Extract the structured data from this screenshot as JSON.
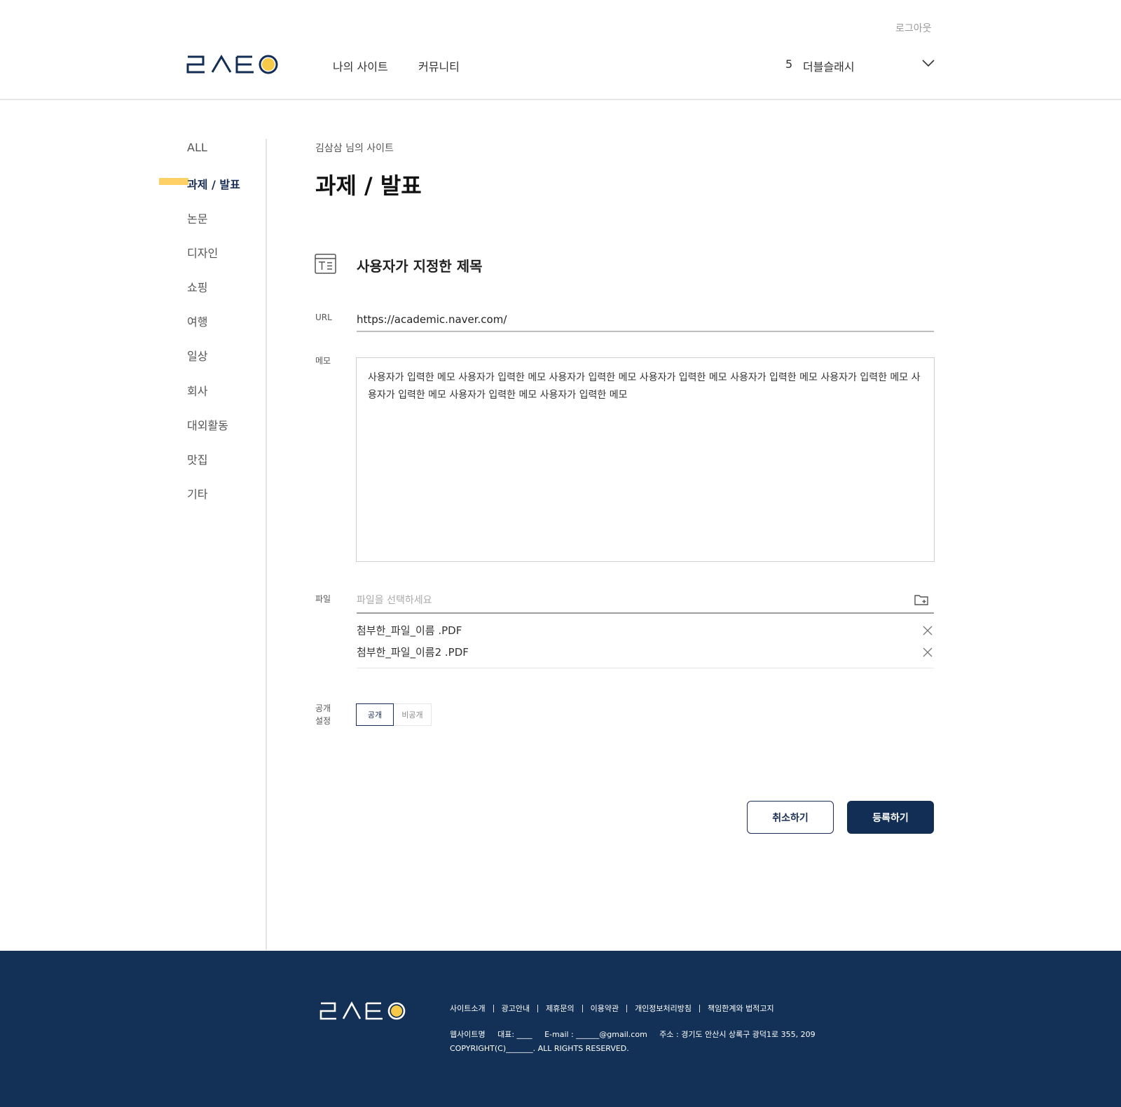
{
  "header": {
    "logout_label": "로그아웃",
    "nav": [
      "나의 사이트",
      "커뮤니티"
    ],
    "user_count": "5",
    "user_name": "더블슬래시"
  },
  "sidebar": {
    "items": [
      "ALL",
      "과제 / 발표",
      "논문",
      "디자인",
      "쇼핑",
      "여행",
      "일상",
      "회사",
      "대외활동",
      "맛집",
      "기타"
    ],
    "active_index": 1
  },
  "main": {
    "breadcrumb": "김삼삼 님의 사이트",
    "page_title": "과제 / 발표",
    "custom_title": "사용자가 지정한 제목",
    "url_label": "URL",
    "url_value": "https://academic.naver.com/",
    "memo_label": "메모",
    "memo_value": "사용자가 입력한 메모 사용자가 입력한 메모 사용자가 입력한 메모 사용자가 입력한 메모 사용자가 입력한 메모 사용자가 입력한 메모 사용자가 입력한 메모 사용자가 입력한 메모 사용자가 입력한 메모",
    "file_label": "파일",
    "file_placeholder": "파일을 선택하세요",
    "files": [
      "첨부한_파일_이름 .PDF",
      "첨부한_파일_이름2 .PDF"
    ],
    "visibility_label": "공개\n설정",
    "visibility_options": [
      "공개",
      "비공개"
    ],
    "visibility_selected": "공개",
    "cancel_label": "취소하기",
    "submit_label": "등록하기"
  },
  "footer": {
    "links": [
      "사이트소개",
      "광고안내",
      "제휴문의",
      "이용약관",
      "개인정보처리방침",
      "책임한계와 법적고지"
    ],
    "site_name": "웹사이트명",
    "rep": "대표: ____",
    "email": "E-mail : ______@gmail.com",
    "address": "주소 : 경기도 안산시 상록구 광덕1로 355, 209",
    "copyright": "COPYRIGHT(C)_______. ALL RIGHTS RESERVED."
  },
  "colors": {
    "navy": "#132e55",
    "accent_yellow": "#f7c948",
    "highlight_yellow": "#ffd066"
  }
}
